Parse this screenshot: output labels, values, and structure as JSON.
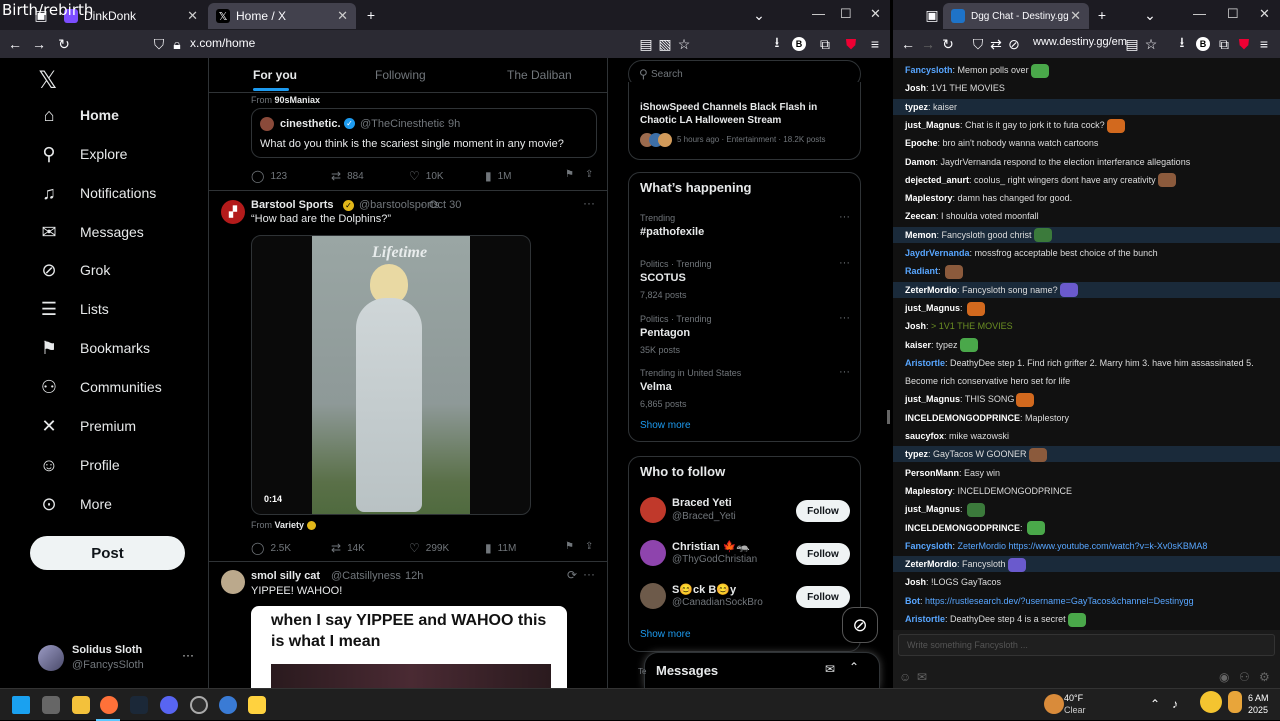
{
  "overlay": {
    "title": "Birth/rebirth"
  },
  "left_browser": {
    "tabs": [
      {
        "label": "DinkDonk",
        "fav_color": "#7c4dff"
      },
      {
        "label": "Home / X",
        "fav_color": "#ffffff"
      }
    ],
    "url": "x.com/home"
  },
  "x_sidebar": {
    "nav": [
      {
        "label": "Home",
        "icon": "home-icon",
        "glyph": "⌂"
      },
      {
        "label": "Explore",
        "icon": "search-icon",
        "glyph": "⚲"
      },
      {
        "label": "Notifications",
        "icon": "bell-icon",
        "glyph": "♫"
      },
      {
        "label": "Messages",
        "icon": "envelope-icon",
        "glyph": "✉"
      },
      {
        "label": "Grok",
        "icon": "grok-icon",
        "glyph": "⊘"
      },
      {
        "label": "Lists",
        "icon": "list-icon",
        "glyph": "☰"
      },
      {
        "label": "Bookmarks",
        "icon": "bookmark-icon",
        "glyph": "⚑"
      },
      {
        "label": "Communities",
        "icon": "communities-icon",
        "glyph": "⚇"
      },
      {
        "label": "Premium",
        "icon": "x-logo-icon",
        "glyph": "✕"
      },
      {
        "label": "Profile",
        "icon": "person-icon",
        "glyph": "☺"
      },
      {
        "label": "More",
        "icon": "more-circle-icon",
        "glyph": "⊙"
      }
    ],
    "post_label": "Post",
    "user": {
      "name": "Solidus Sloth",
      "handle": "@FancysSloth"
    }
  },
  "feed": {
    "tabs": [
      "For you",
      "Following",
      "The Daliban"
    ],
    "tweet1": {
      "from_label": "From",
      "from_name": "90sManiax",
      "quoted_name": "cinesthetic.",
      "quoted_handle": "@TheCinesthetic",
      "quoted_time": "9h",
      "quoted_text": "What do you think is the scariest single moment in any movie?",
      "replies": "123",
      "reposts": "884",
      "likes": "10K",
      "views": "1M"
    },
    "tweet2": {
      "name": "Barstool Sports",
      "handle": "@barstoolsports",
      "time": "Oct 30",
      "text": "“How bad are the Dolphins?”",
      "video_time": "0:14",
      "video_brand": "Lifetime",
      "from_label": "From",
      "from_name": "Variety",
      "replies": "2.5K",
      "reposts": "14K",
      "likes": "299K",
      "views": "11M"
    },
    "tweet3": {
      "name": "smol silly cat",
      "handle": "@Catsillyness",
      "time": "12h",
      "text": "YIPPEE! WAHOO!",
      "meme_text": "when I say YIPPEE and WAHOO this is what I mean"
    }
  },
  "right_col": {
    "search_placeholder": "Search",
    "live": {
      "title": "iShowSpeed Channels Black Flash in Chaotic LA Halloween Stream",
      "meta": "5 hours ago · Entertainment · 18.2K posts"
    },
    "happening_title": "What’s happening",
    "trends": [
      {
        "meta": "Trending",
        "name": "#pathofexile",
        "posts": ""
      },
      {
        "meta": "Politics · Trending",
        "name": "SCOTUS",
        "posts": "7,824 posts"
      },
      {
        "meta": "Politics · Trending",
        "name": "Pentagon",
        "posts": "35K posts"
      },
      {
        "meta": "Trending in United States",
        "name": "Velma",
        "posts": "6,865 posts"
      }
    ],
    "show_more": "Show more",
    "who_title": "Who to follow",
    "follows": [
      {
        "name": "Braced Yeti",
        "handle": "@Braced_Yeti",
        "color": "#c0392b"
      },
      {
        "name": "Christian 🍁🦡",
        "handle": "@ThyGodChristian",
        "color": "#8e44ad"
      },
      {
        "name": "S😊ck B😊y",
        "handle": "@CanadianSockBro",
        "color": "#6d5a4a"
      }
    ],
    "follow_label": "Follow",
    "show_more2": "Show more",
    "messages_label": "Messages"
  },
  "right_browser": {
    "tab": "Dgg Chat - Destiny.gg",
    "url": "www.destiny.gg/em",
    "input_placeholder": "Write something Fancysloth ...",
    "messages": [
      {
        "user": "Fancysloth",
        "text": "Memon polls over",
        "color": "#58a6ff",
        "hl": false
      },
      {
        "user": "Josh",
        "text": "1V1 THE MOVIES",
        "color": "#ffffff",
        "hl": false
      },
      {
        "user": "typez",
        "text": "kaiser",
        "color": "#ffffff",
        "hl": true
      },
      {
        "user": "just_Magnus",
        "text": "Chat is it gay to jork it to futa cock?",
        "color": "#ffffff",
        "hl": false
      },
      {
        "user": "Epoche",
        "text": "bro ain't nobody wanna watch cartoons",
        "color": "#ffffff",
        "hl": false
      },
      {
        "user": "Damon",
        "text": "JaydrVernanda respond to the election interferance allegations",
        "color": "#ffffff",
        "hl": false
      },
      {
        "user": "dejected_anurt",
        "text": "coolus_ right wingers dont have any creativity",
        "color": "#ffffff",
        "hl": false
      },
      {
        "user": "Maplestory",
        "text": "damn       has changed for good.",
        "color": "#ffffff",
        "hl": false
      },
      {
        "user": "Zeecan",
        "text": "I shoulda voted moonfall",
        "color": "#ffffff",
        "hl": false
      },
      {
        "user": "Memon",
        "text": "Fancysloth good christ",
        "color": "#ffffff",
        "hl": true
      },
      {
        "user": "JaydrVernanda",
        "text": "mossfrog acceptable best choice of the bunch",
        "color": "#58a6ff",
        "hl": false
      },
      {
        "user": "Radiant",
        "text": "",
        "color": "#58a6ff",
        "hl": false
      },
      {
        "user": "ZeterMordio",
        "text": "Fancysloth song name?",
        "color": "#ffffff",
        "hl": true
      },
      {
        "user": "just_Magnus",
        "text": "",
        "color": "#ffffff",
        "hl": false
      },
      {
        "user": "Josh",
        "text": "> 1V1 THE MOVIES",
        "color": "#ffffff",
        "hl": false
      },
      {
        "user": "kaiser",
        "text": "typez",
        "color": "#ffffff",
        "hl": false
      },
      {
        "user": "Aristortle",
        "text": "DeathyDee step 1. Find rich grifter 2. Marry him 3. have him assassinated 5.",
        "color": "#58a6ff",
        "hl": false
      },
      {
        "user": "",
        "text": "Become rich conservative hero set for life",
        "color": "#ffffff",
        "hl": false
      },
      {
        "user": "just_Magnus",
        "text": "THIS SONG",
        "color": "#ffffff",
        "hl": false
      },
      {
        "user": "INCELDEMONGODPRINCE",
        "text": "Maplestory",
        "color": "#ffffff",
        "hl": false
      },
      {
        "user": "saucyfox",
        "text": "mike wazowski",
        "color": "#ffffff",
        "hl": false
      },
      {
        "user": "typez",
        "text": "GayTacos     W GOONER",
        "color": "#ffffff",
        "hl": true
      },
      {
        "user": "PersonMann",
        "text": "Easy win",
        "color": "#ffffff",
        "hl": false
      },
      {
        "user": "Maplestory",
        "text": "INCELDEMONGODPRINCE",
        "color": "#ffffff",
        "hl": false
      },
      {
        "user": "just_Magnus",
        "text": "",
        "color": "#ffffff",
        "hl": false
      },
      {
        "user": "INCELDEMONGODPRINCE",
        "text": "",
        "color": "#ffffff",
        "hl": false
      },
      {
        "user": "Fancysloth",
        "text": "ZeterMordio https://www.youtube.com/watch?v=k-Xv0sKBMA8",
        "color": "#58a6ff",
        "hl": false
      },
      {
        "user": "ZeterMordio",
        "text": "Fancysloth",
        "color": "#ffffff",
        "hl": true
      },
      {
        "user": "Josh",
        "text": "!LOGS GayTacos",
        "color": "#ffffff",
        "hl": false
      },
      {
        "user": "Bot",
        "text": "https://rustlesearch.dev/?username=GayTacos&channel=Destinygg",
        "color": "#58a6ff",
        "hl": false
      },
      {
        "user": "Aristortle",
        "text": "DeathyDee step 4 is a secret",
        "color": "#58a6ff",
        "hl": false
      }
    ]
  },
  "taskbar": {
    "weather_temp": "40°F",
    "weather_desc": "Clear",
    "time": "6 AM",
    "date": "2025"
  }
}
